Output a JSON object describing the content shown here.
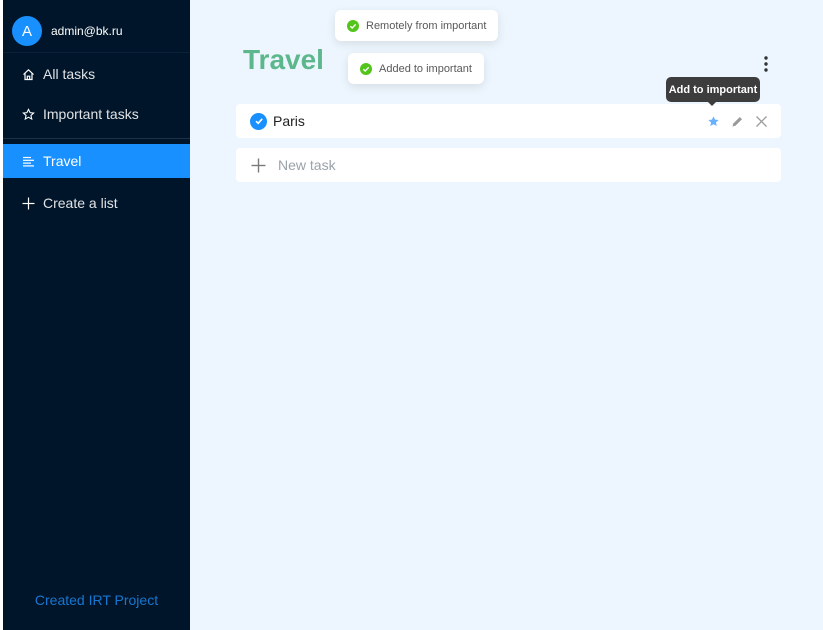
{
  "user": {
    "avatar_letter": "A",
    "email": "admin@bk.ru"
  },
  "sidebar": {
    "items": [
      {
        "label": "All tasks",
        "icon": "home-icon"
      },
      {
        "label": "Important tasks",
        "icon": "star-outline-icon"
      },
      {
        "label": "Travel",
        "icon": "list-icon",
        "active": true
      },
      {
        "label": "Create a list",
        "icon": "plus-icon"
      }
    ],
    "footer": "Created IRT Project"
  },
  "main": {
    "list_title": "Travel",
    "tasks": [
      {
        "title": "Paris",
        "completed": true,
        "important": true
      }
    ],
    "new_task": {
      "placeholder": "New task",
      "value": ""
    }
  },
  "notifications": [
    {
      "text": "Remotely from important",
      "icon": "check-circle-icon"
    },
    {
      "text": "Added to important",
      "icon": "check-circle-icon"
    }
  ],
  "tooltip": {
    "text": "Add to important"
  },
  "colors": {
    "sidebar_bg": "#001529",
    "accent": "#1890ff",
    "title_green": "#5cb88c",
    "main_bg": "#edf6fe",
    "success": "#52c41a"
  }
}
